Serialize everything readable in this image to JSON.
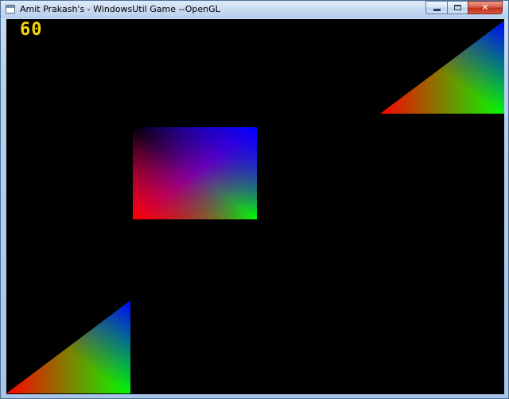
{
  "window": {
    "title": "Amit Prakash's - WindowsUtil Game --OpenGL",
    "buttons": {
      "minimize_glyph": "minimize-icon",
      "maximize_glyph": "maximize-icon",
      "close_label": "✕"
    }
  },
  "game": {
    "fps": "60",
    "background_color": "#000000",
    "fps_color": "#f4d60b",
    "shapes": [
      {
        "kind": "triangle",
        "name": "top-right-triangle",
        "colors": [
          "#ff0000",
          "#00ff00",
          "#0000ff"
        ]
      },
      {
        "kind": "rectangle",
        "name": "center-rectangle",
        "colors": [
          "#000000",
          "#0000ff",
          "#ff0000",
          "#00ff00"
        ]
      },
      {
        "kind": "triangle",
        "name": "bottom-left-triangle",
        "colors": [
          "#ff0000",
          "#00ff00",
          "#0000ff"
        ]
      }
    ]
  }
}
